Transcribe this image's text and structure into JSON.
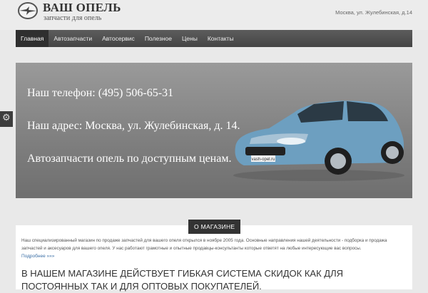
{
  "header": {
    "logo_title": "ВАШ ОПЕЛЬ",
    "logo_subtitle": "запчасти для опель",
    "address": "Москва, ул. Жулебинская, д.14"
  },
  "nav": {
    "items": [
      "Главная",
      "Автозапчасти",
      "Автосервис",
      "Полезное",
      "Цены",
      "Контакты"
    ],
    "active_index": 0
  },
  "hero": {
    "phone_line": "Наш телефон: (495) 506-65-31",
    "address_line": "Наш адрес: Москва, ул. Жулебинская, д. 14.",
    "slogan_line": "Автозапчасти опель по доступным ценам.",
    "car_plate": "vash-opel.ru"
  },
  "about": {
    "section_label": "О МАГАЗИНЕ",
    "text": "Наш специализированный магазин по продаже запчастей для вашего опеля открылся в ноябре 2005 года. Основные направления нашей деятельности - подборка и продажа запчастей и аксесуаров для вашего опеля. У нас работают грамотные и опытные продавцы-консультанты которые ответят на любые интересующие вас вопросы.",
    "more_link": "Подробнее »»»",
    "headline": "В нашем магазине действует гибкая система скидок как для постоянных так и для оптовых покупателей."
  },
  "colors": {
    "nav_bg": "#4f4f4f",
    "nav_active": "#2f2f2f",
    "hero_bg": "#8a8a8a",
    "car_body": "#6d9fc0",
    "link": "#3a6ea5"
  },
  "icons": [
    "opel-logo-icon",
    "gear-icon"
  ]
}
